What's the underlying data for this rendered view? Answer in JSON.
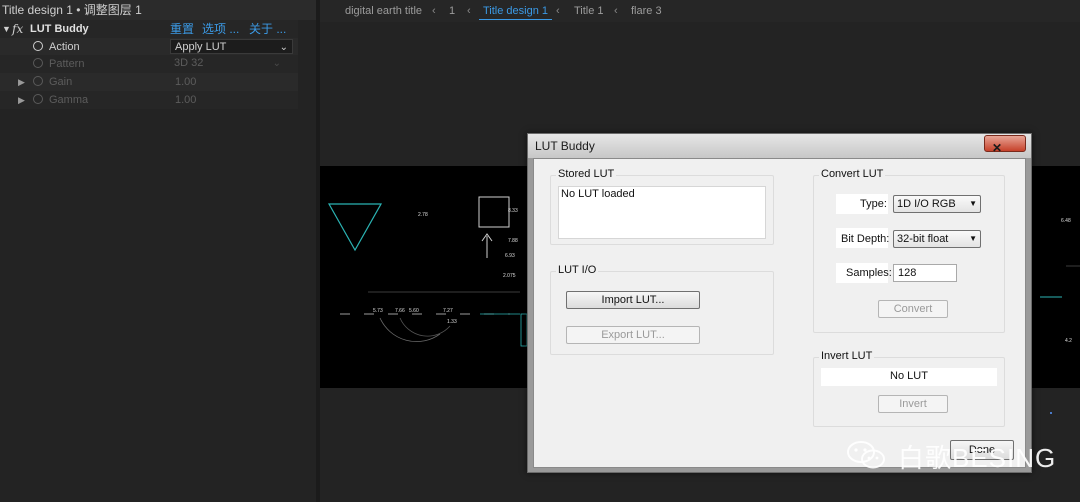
{
  "effect_controls": {
    "header": "Title design 1 • 调整图层 1",
    "effect": {
      "fx_label": "fx",
      "name": "LUT Buddy",
      "reset_link": "重置",
      "options_link": "选项 ...",
      "about_link": "关于 ..."
    },
    "params": [
      {
        "label": "Action",
        "value": "Apply LUT",
        "enabled": true
      },
      {
        "label": "Pattern",
        "value": "3D 32",
        "enabled": false
      },
      {
        "label": "Gain",
        "value": "1.00",
        "enabled": false
      },
      {
        "label": "Gamma",
        "value": "1.00",
        "enabled": false
      }
    ]
  },
  "viewer": {
    "breadcrumbs": [
      "digital earth title",
      "1",
      "Title design 1",
      "Title 1",
      "flare 3"
    ],
    "active_index": 2,
    "accent": "#3b9ae6"
  },
  "dialog": {
    "title": "LUT Buddy",
    "close_icon": "close-icon",
    "stored_lut": {
      "label": "Stored LUT",
      "text": "No LUT loaded"
    },
    "lut_io": {
      "label": "LUT I/O",
      "import_button": "Import LUT...",
      "export_button": "Export LUT..."
    },
    "convert_lut": {
      "label": "Convert LUT",
      "type_label": "Type:",
      "type_value": "1D I/O RGB",
      "bit_depth_label": "Bit Depth:",
      "bit_depth_value": "32-bit float",
      "samples_label": "Samples:",
      "samples_value": "128",
      "convert_button": "Convert"
    },
    "invert_lut": {
      "label": "Invert LUT",
      "text": "No LUT",
      "invert_button": "Invert"
    },
    "done_button": "Done"
  },
  "watermark": {
    "text": "白歌BESING"
  },
  "canvas_labels": [
    "2.78",
    "8.33",
    "7.88",
    "6.93",
    "2.075",
    "5.73",
    "7.66",
    "5.60",
    "7.27",
    "1.33",
    "6.48",
    "4.2"
  ]
}
